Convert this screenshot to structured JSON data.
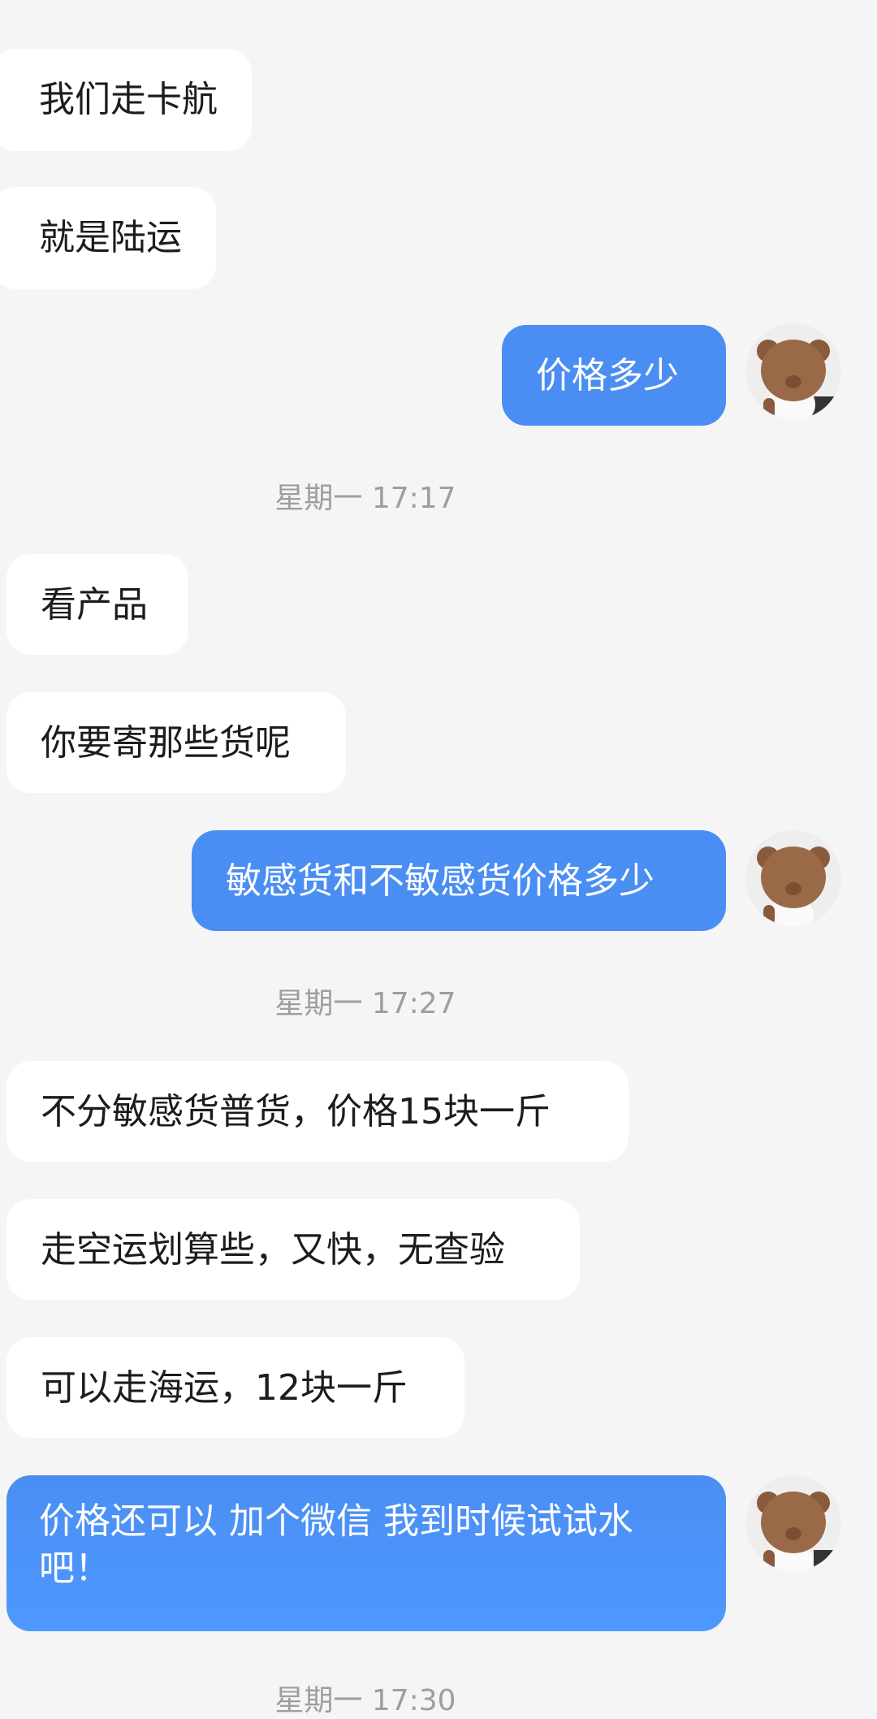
{
  "messages": {
    "m1": "我们走卡航",
    "m2": "就是陆运",
    "m3": "价格多少",
    "m4": "看产品",
    "m5": "你要寄那些货呢",
    "m6": "敏感货和不敏感货价格多少",
    "m7": "不分敏感货普货，价格15块一斤",
    "m8": "走空运划算些，又快，无查验",
    "m9": "可以走海运，12块一斤",
    "m10": "价格还可以 加个微信  我到时候试试水吧！"
  },
  "timestamps": {
    "t1": "星期一 17:17",
    "t2": "星期一 17:27",
    "t3": "星期一 17:30"
  },
  "colors": {
    "background": "#f5f5f5",
    "incoming_bubble": "#ffffff",
    "outgoing_bubble": "#4a8ef3",
    "timestamp_text": "#9e9e9e"
  },
  "avatar": {
    "icon": "bear-figurine-avatar-icon"
  }
}
